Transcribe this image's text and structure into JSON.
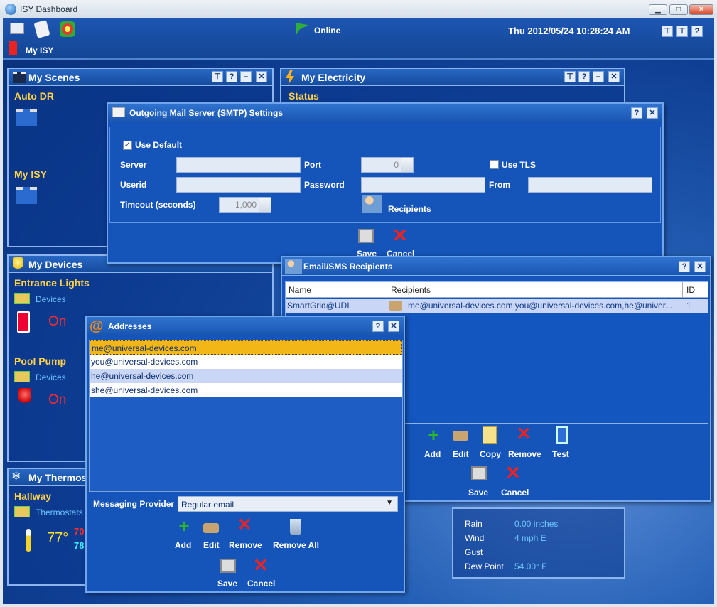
{
  "app": {
    "title": "ISY Dashboard",
    "status": "Online",
    "datetime": "Thu 2012/05/24 10:28:24 AM",
    "my_isy": "My ISY"
  },
  "window_buttons": {
    "minimize": "▁",
    "maximize": "□",
    "close": "✕"
  },
  "scenes": {
    "title": "My Scenes",
    "auto_dr": "Auto DR",
    "my_isy": "My ISY"
  },
  "electricity": {
    "title": "My Electricity",
    "status": "Status"
  },
  "devices": {
    "title": "My Devices",
    "entrance": "Entrance Lights",
    "entrance_link": "Devices",
    "entrance_state": "On",
    "pool": "Pool Pump",
    "pool_link": "Devices",
    "pool_state": "On"
  },
  "thermostat": {
    "title": "My Thermostat",
    "hallway": "Hallway",
    "link": "Thermostats",
    "temp": "77°",
    "heat": "70°",
    "cool": "78°"
  },
  "weather": {
    "labels": [
      "Rain",
      "Wind",
      "Gust",
      "Dew Point"
    ],
    "values": [
      "0.00 inches",
      "4 mph E",
      "",
      "54.00° F"
    ]
  },
  "smtp": {
    "title": "Outgoing Mail Server (SMTP) Settings",
    "use_default": "Use Default",
    "server": "Server",
    "port": "Port",
    "port_value": "0",
    "use_tls": "Use TLS",
    "userid": "Userid",
    "password": "Password",
    "from": "From",
    "timeout": "Timeout (seconds)",
    "timeout_value": "1,000",
    "recipients": "Recipients",
    "save": "Save",
    "cancel": "Cancel"
  },
  "recipients": {
    "title": "Email/SMS Recipients",
    "columns": [
      "Name",
      "Recipients",
      "ID"
    ],
    "rows": [
      {
        "name": "SmartGrid@UDI",
        "recipients": "me@universal-devices.com,you@universal-devices.com,he@univer...",
        "id": "1"
      }
    ],
    "buttons": {
      "add": "Add",
      "edit": "Edit",
      "copy": "Copy",
      "remove": "Remove",
      "test": "Test",
      "save": "Save",
      "cancel": "Cancel"
    }
  },
  "addresses": {
    "title": "Addresses",
    "items": [
      "me@universal-devices.com",
      "you@universal-devices.com",
      "he@universal-devices.com",
      "she@universal-devices.com"
    ],
    "provider_label": "Messaging Provider",
    "provider": "Regular email",
    "buttons": {
      "add": "Add",
      "edit": "Edit",
      "remove": "Remove",
      "remove_all": "Remove All",
      "save": "Save",
      "cancel": "Cancel"
    }
  },
  "colors": {
    "accent": "#ffd24a",
    "on": "#ff2b2b",
    "link": "#6fc6ff"
  }
}
